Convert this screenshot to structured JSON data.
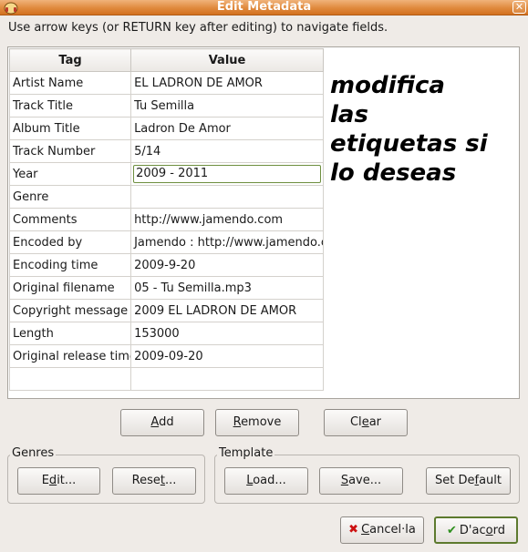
{
  "window": {
    "title": "Edit Metadata",
    "close_symbol": "✕"
  },
  "instructions": "Use arrow keys (or RETURN key after editing) to navigate fields.",
  "table": {
    "headers": {
      "tag": "Tag",
      "value": "Value"
    },
    "rows": [
      {
        "tag": "Artist Name",
        "value": "EL LADRON DE AMOR"
      },
      {
        "tag": "Track Title",
        "value": "Tu Semilla"
      },
      {
        "tag": "Album Title",
        "value": "Ladron De Amor"
      },
      {
        "tag": "Track Number",
        "value": "5/14"
      },
      {
        "tag": "Year",
        "value": "2009 - 2011"
      },
      {
        "tag": "Genre",
        "value": ""
      },
      {
        "tag": "Comments",
        "value": "http://www.jamendo.com"
      },
      {
        "tag": "Encoded by",
        "value": "Jamendo : http://www.jamendo.com"
      },
      {
        "tag": "Encoding time",
        "value": "2009-9-20"
      },
      {
        "tag": "Original filename",
        "value": "05 - Tu Semilla.mp3"
      },
      {
        "tag": "Copyright message",
        "value": "2009 EL LADRON DE AMOR"
      },
      {
        "tag": "Length",
        "value": "153000"
      },
      {
        "tag": "Original release time",
        "value": "2009-09-20"
      },
      {
        "tag": "",
        "value": ""
      }
    ]
  },
  "overlay_text": [
    "modifica",
    "las",
    "etiquetas si",
    "lo deseas"
  ],
  "buttons": {
    "add": {
      "pre": "",
      "key": "A",
      "post": "dd"
    },
    "remove": {
      "pre": "",
      "key": "R",
      "post": "emove"
    },
    "clear": {
      "pre": "Cl",
      "key": "e",
      "post": "ar"
    }
  },
  "genres": {
    "label": "Genres",
    "edit": {
      "pre": "E",
      "key": "d",
      "post": "it..."
    },
    "reset": {
      "pre": "Rese",
      "key": "t",
      "post": "..."
    }
  },
  "template": {
    "label": "Template",
    "load": {
      "pre": "",
      "key": "L",
      "post": "oad..."
    },
    "save": {
      "pre": "",
      "key": "S",
      "post": "ave..."
    },
    "set_default": {
      "pre": "Set De",
      "key": "f",
      "post": "ault"
    }
  },
  "dialog": {
    "cancel": {
      "pre": "",
      "key": "C",
      "post": "ancel·la"
    },
    "ok": {
      "pre": "D'ac",
      "key": "o",
      "post": "rd"
    }
  },
  "colors": {
    "titlebar": "#e08a3d",
    "overlay_text": "#000000",
    "focus": "#6e8f3f"
  }
}
